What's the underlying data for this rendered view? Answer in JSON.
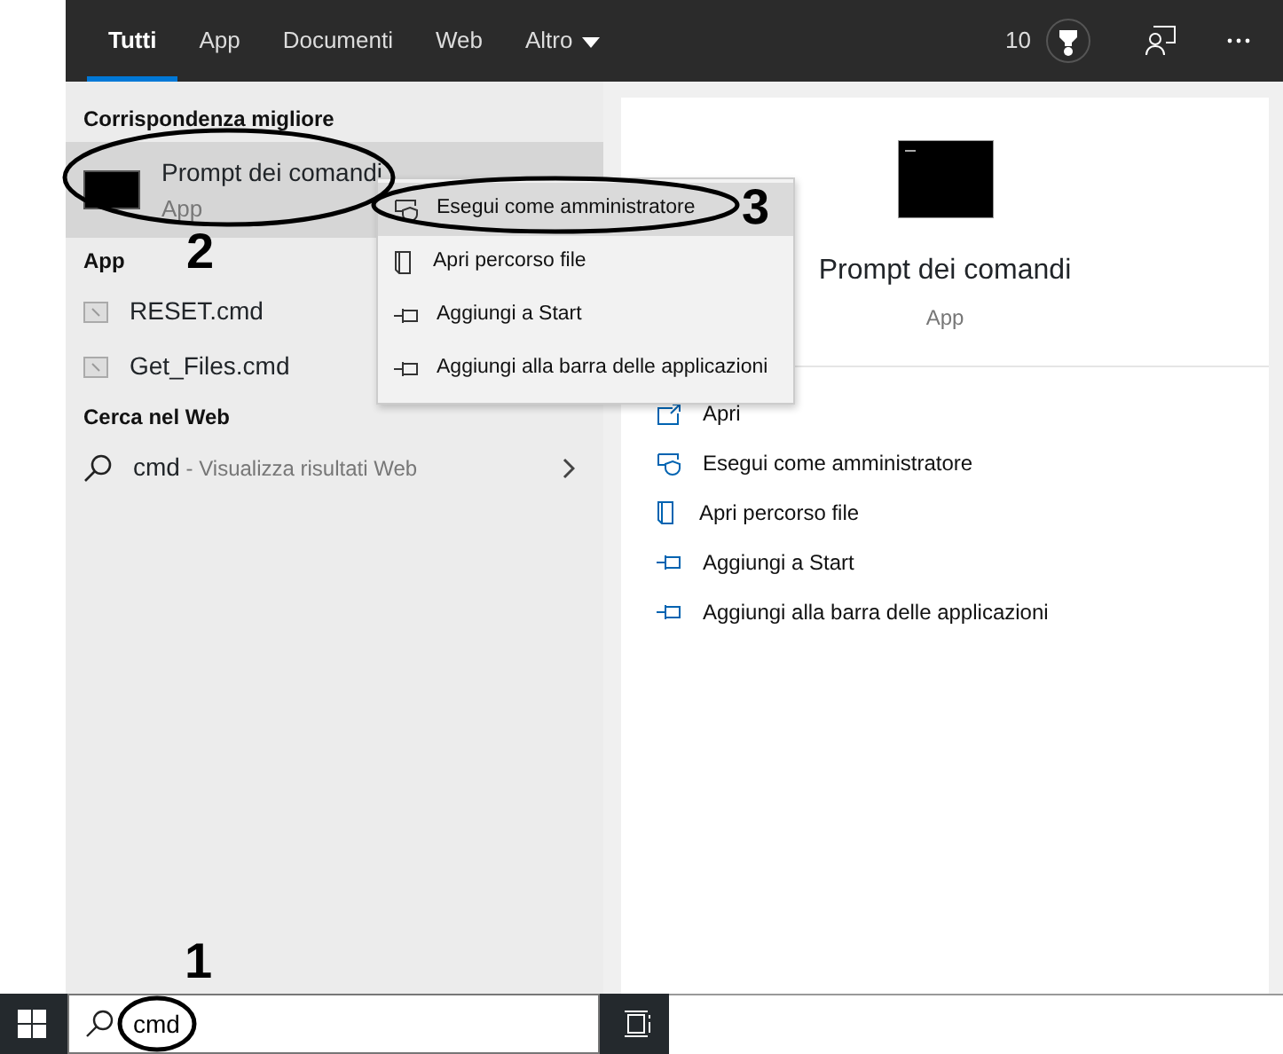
{
  "tabs": [
    {
      "label": "Tutti",
      "selected": true
    },
    {
      "label": "App",
      "selected": false
    },
    {
      "label": "Documenti",
      "selected": false
    },
    {
      "label": "Web",
      "selected": false
    },
    {
      "label": "Altro",
      "selected": false,
      "dropdown": true
    }
  ],
  "header": {
    "points": "10"
  },
  "best_match": {
    "heading": "Corrispondenza migliore",
    "title": "Prompt dei comandi",
    "subtitle": "App",
    "selected": true
  },
  "sections": [
    {
      "heading": "App",
      "items": [
        {
          "kind": "file",
          "label": "RESET.cmd"
        },
        {
          "kind": "file",
          "label": "Get_Files.cmd"
        }
      ]
    },
    {
      "heading": "Cerca nel Web",
      "items": [
        {
          "kind": "web",
          "label": "cmd",
          "hint": "- Visualizza risultati Web"
        }
      ]
    }
  ],
  "context_menu": [
    {
      "kind": "shield",
      "label": "Esegui come amministratore",
      "selected": true
    },
    {
      "kind": "folder",
      "label": "Apri percorso file",
      "selected": false
    },
    {
      "kind": "pin",
      "label": "Aggiungi a Start",
      "selected": false
    },
    {
      "kind": "pin",
      "label": "Aggiungi alla barra delle applicazioni",
      "selected": false
    }
  ],
  "preview": {
    "title": "Prompt dei comandi",
    "subtitle": "App",
    "actions": [
      {
        "kind": "open",
        "label": "Apri"
      },
      {
        "kind": "shield",
        "label": "Esegui come amministratore"
      },
      {
        "kind": "folder",
        "label": "Apri percorso file"
      },
      {
        "kind": "pin",
        "label": "Aggiungi a Start"
      },
      {
        "kind": "pin",
        "label": "Aggiungi alla barra delle applicazioni"
      }
    ]
  },
  "search": {
    "value": "cmd"
  },
  "annotations": [
    "1",
    "2",
    "3"
  ]
}
